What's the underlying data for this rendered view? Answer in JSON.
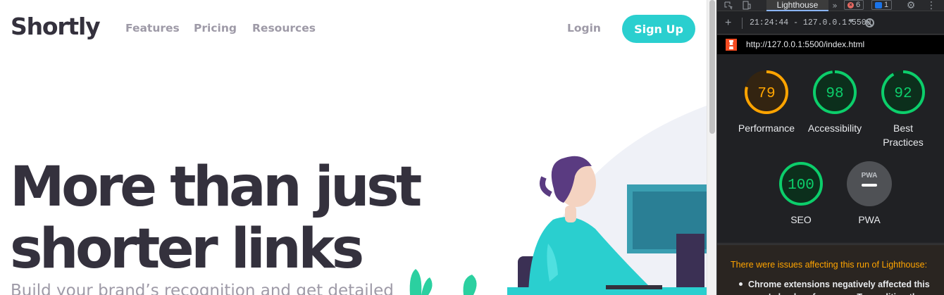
{
  "site": {
    "logo": "Shortly",
    "nav": {
      "features": "Features",
      "pricing": "Pricing",
      "resources": "Resources"
    },
    "login": "Login",
    "signup": "Sign Up",
    "hero_title": "More than just shorter links",
    "hero_subtitle": "Build your brand’s recognition and get detailed"
  },
  "devtools": {
    "tabs": {
      "active": "Lighthouse",
      "more": "»"
    },
    "errors_count": "6",
    "messages_count": "1",
    "report_select": "21:24:44 - 127.0.0.1:5500",
    "url": "http://127.0.0.1:5500/index.html",
    "categories": [
      {
        "label": "Performance",
        "score": "79",
        "fraction": 0.79,
        "status": "average"
      },
      {
        "label": "Accessibility",
        "score": "98",
        "fraction": 0.98,
        "status": "pass"
      },
      {
        "label": "Best Practices",
        "score": "92",
        "fraction": 0.92,
        "status": "pass"
      },
      {
        "label": "SEO",
        "score": "100",
        "fraction": 1.0,
        "status": "pass"
      },
      {
        "label": "PWA",
        "score": "",
        "fraction": 0,
        "status": "pwa"
      }
    ],
    "pwa_badge": "PWA",
    "warnings": {
      "title": "There were issues affecting this run of Lighthouse:",
      "item": "Chrome extensions negatively affected this page's load performance. Try auditing the page"
    }
  },
  "colors": {
    "brand_cyan": "#2acfcf",
    "dark_violet": "#3b3054",
    "text_dark": "#34313d",
    "gray": "#9e9aa7",
    "lh_pass": "#0cce6b",
    "lh_average": "#ffa400",
    "lh_fail": "#ff4e42"
  },
  "icons": [
    "inspect-icon",
    "device-toolbar-icon",
    "more-tabs-icon",
    "error-icon",
    "message-icon",
    "settings-gear-icon",
    "kebab-menu-icon",
    "plus-icon",
    "dropdown-caret-icon",
    "clear-icon",
    "lighthouse-logo-icon"
  ]
}
